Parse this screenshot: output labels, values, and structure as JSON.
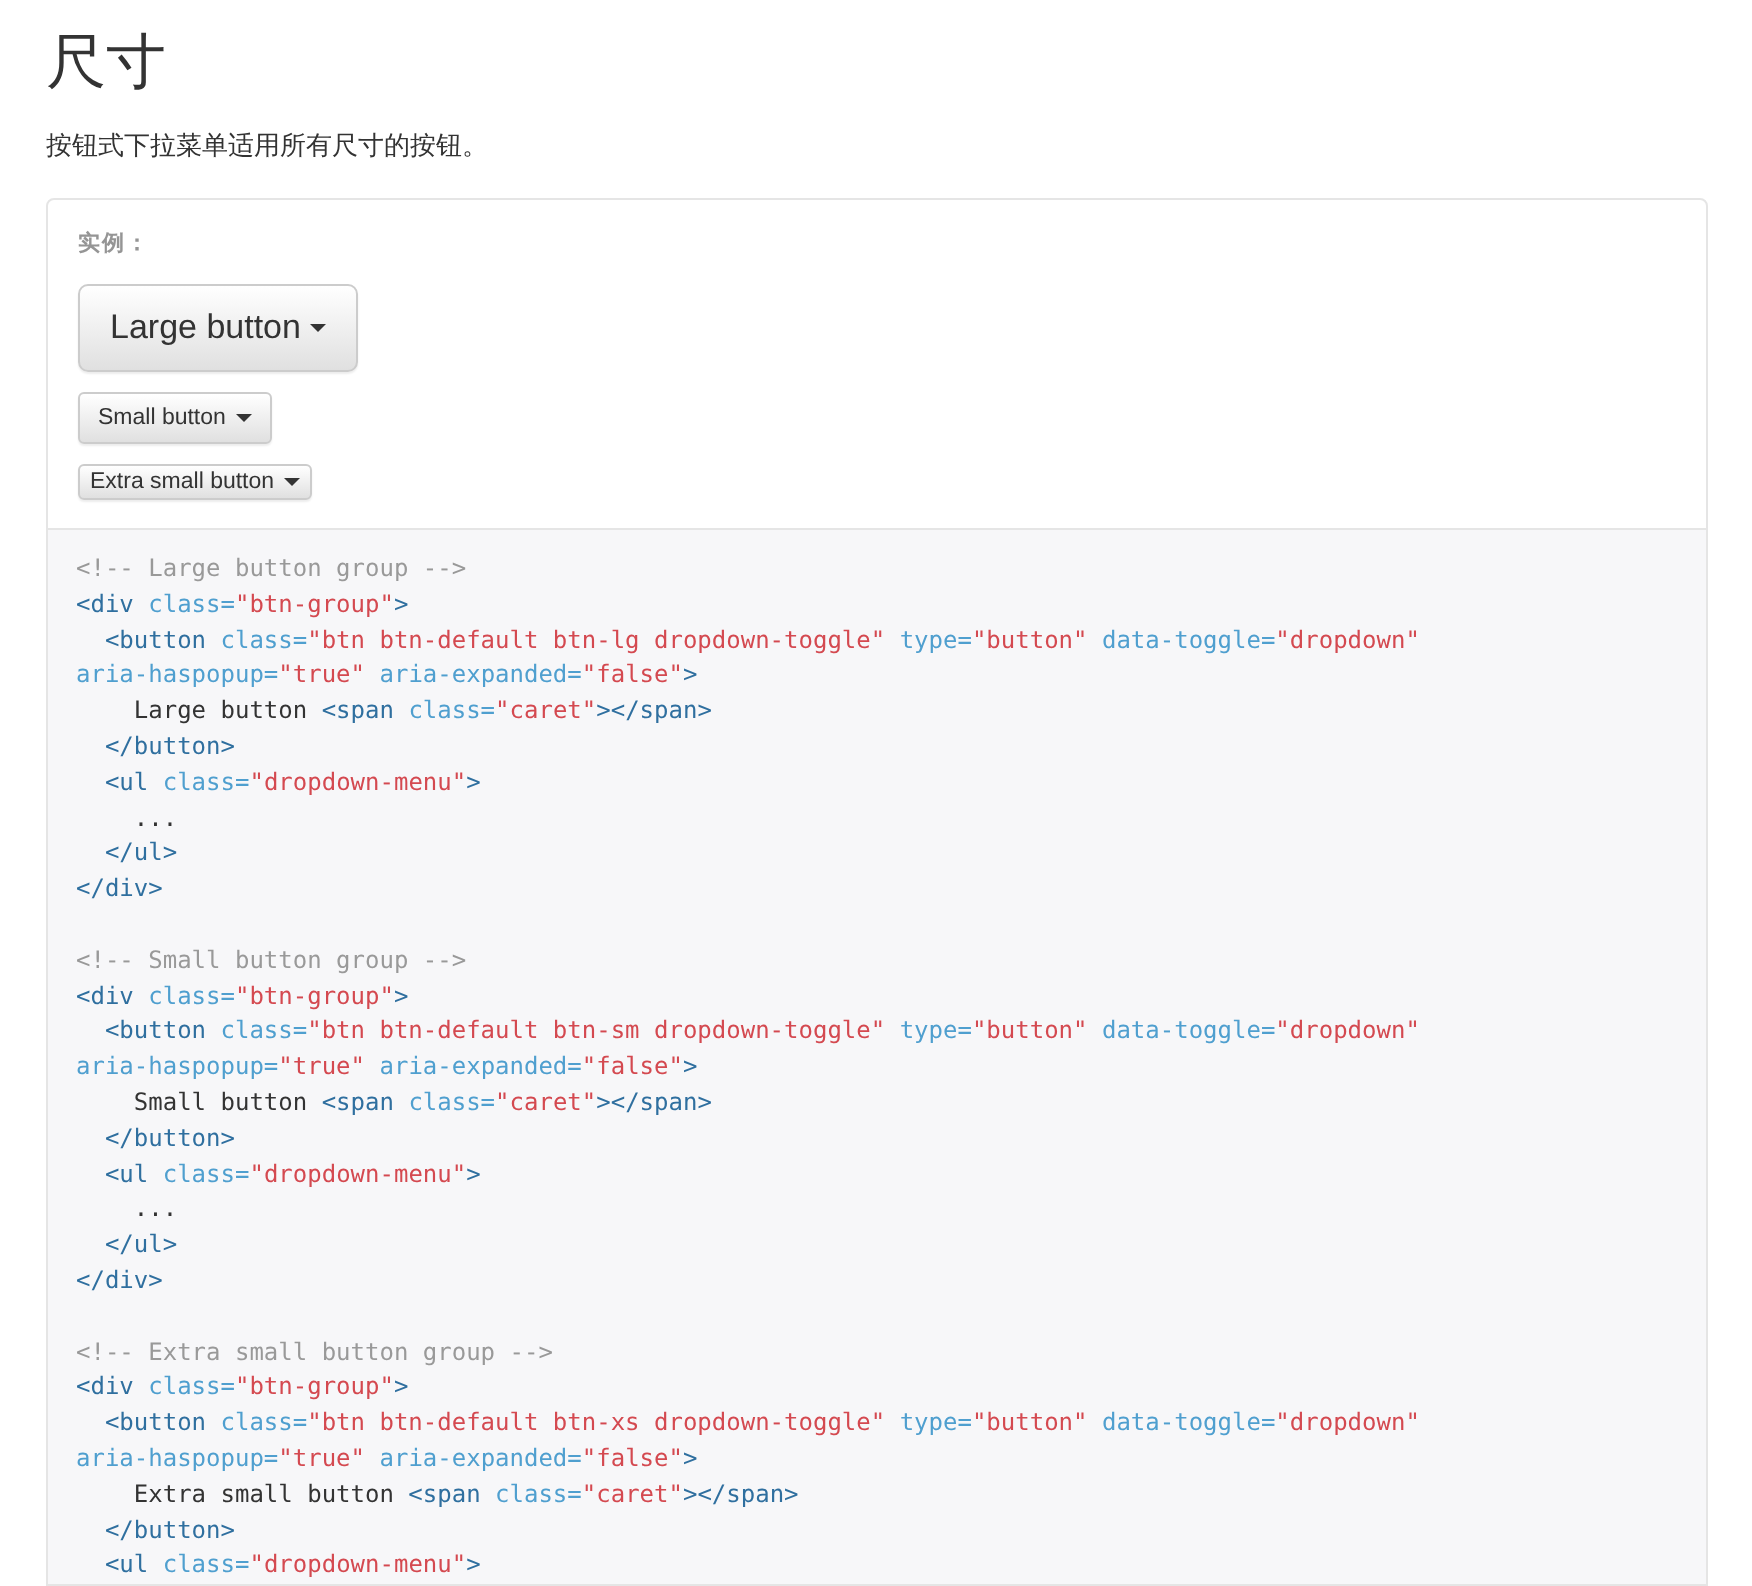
{
  "heading": "尺寸",
  "description": "按钮式下拉菜单适用所有尺寸的按钮。",
  "example": {
    "label": "实例：",
    "buttons": [
      {
        "kind": "large",
        "label": "Large button"
      },
      {
        "kind": "small",
        "label": "Small button"
      },
      {
        "kind": "mini",
        "label": "Extra small button"
      }
    ]
  },
  "code_blocks": [
    {
      "lines": [
        [
          {
            "kind": "comment",
            "text": "<!-- Large button group -->"
          }
        ],
        [
          {
            "kind": "tag",
            "text": "<div "
          },
          {
            "kind": "attr",
            "text": "class="
          },
          {
            "kind": "string",
            "text": "\"btn-group\""
          },
          {
            "kind": "tag",
            "text": ">"
          }
        ],
        [
          {
            "kind": "tag",
            "text": "  <button "
          },
          {
            "kind": "attr",
            "text": "class="
          },
          {
            "kind": "string",
            "text": "\"btn btn-default btn-lg dropdown-toggle\""
          },
          {
            "kind": "attr",
            "text": " type="
          },
          {
            "kind": "string",
            "text": "\"button\""
          },
          {
            "kind": "attr",
            "text": " data-toggle="
          },
          {
            "kind": "string",
            "text": "\"dropdown\""
          }
        ],
        [
          {
            "kind": "attr",
            "text": "aria-haspopup="
          },
          {
            "kind": "string",
            "text": "\"true\""
          },
          {
            "kind": "attr",
            "text": " aria-expanded="
          },
          {
            "kind": "string",
            "text": "\"false\""
          },
          {
            "kind": "tag",
            "text": ">"
          }
        ],
        [
          {
            "kind": "text",
            "text": "    Large button "
          },
          {
            "kind": "tag",
            "text": "<span "
          },
          {
            "kind": "attr",
            "text": "class="
          },
          {
            "kind": "string",
            "text": "\"caret\""
          },
          {
            "kind": "tag",
            "text": "></span>"
          }
        ],
        [
          {
            "kind": "tag",
            "text": "  </button>"
          }
        ],
        [
          {
            "kind": "tag",
            "text": "  <ul "
          },
          {
            "kind": "attr",
            "text": "class="
          },
          {
            "kind": "string",
            "text": "\"dropdown-menu\""
          },
          {
            "kind": "tag",
            "text": ">"
          }
        ],
        [
          {
            "kind": "text",
            "text": "    ..."
          }
        ],
        [
          {
            "kind": "tag",
            "text": "  </ul>"
          }
        ],
        [
          {
            "kind": "tag",
            "text": "</div>"
          }
        ]
      ]
    },
    {
      "lines": [
        [
          {
            "kind": "comment",
            "text": "<!-- Small button group -->"
          }
        ],
        [
          {
            "kind": "tag",
            "text": "<div "
          },
          {
            "kind": "attr",
            "text": "class="
          },
          {
            "kind": "string",
            "text": "\"btn-group\""
          },
          {
            "kind": "tag",
            "text": ">"
          }
        ],
        [
          {
            "kind": "tag",
            "text": "  <button "
          },
          {
            "kind": "attr",
            "text": "class="
          },
          {
            "kind": "string",
            "text": "\"btn btn-default btn-sm dropdown-toggle\""
          },
          {
            "kind": "attr",
            "text": " type="
          },
          {
            "kind": "string",
            "text": "\"button\""
          },
          {
            "kind": "attr",
            "text": " data-toggle="
          },
          {
            "kind": "string",
            "text": "\"dropdown\""
          }
        ],
        [
          {
            "kind": "attr",
            "text": "aria-haspopup="
          },
          {
            "kind": "string",
            "text": "\"true\""
          },
          {
            "kind": "attr",
            "text": " aria-expanded="
          },
          {
            "kind": "string",
            "text": "\"false\""
          },
          {
            "kind": "tag",
            "text": ">"
          }
        ],
        [
          {
            "kind": "text",
            "text": "    Small button "
          },
          {
            "kind": "tag",
            "text": "<span "
          },
          {
            "kind": "attr",
            "text": "class="
          },
          {
            "kind": "string",
            "text": "\"caret\""
          },
          {
            "kind": "tag",
            "text": "></span>"
          }
        ],
        [
          {
            "kind": "tag",
            "text": "  </button>"
          }
        ],
        [
          {
            "kind": "tag",
            "text": "  <ul "
          },
          {
            "kind": "attr",
            "text": "class="
          },
          {
            "kind": "string",
            "text": "\"dropdown-menu\""
          },
          {
            "kind": "tag",
            "text": ">"
          }
        ],
        [
          {
            "kind": "text",
            "text": "    ..."
          }
        ],
        [
          {
            "kind": "tag",
            "text": "  </ul>"
          }
        ],
        [
          {
            "kind": "tag",
            "text": "</div>"
          }
        ]
      ]
    },
    {
      "lines": [
        [
          {
            "kind": "comment",
            "text": "<!-- Extra small button group -->"
          }
        ],
        [
          {
            "kind": "tag",
            "text": "<div "
          },
          {
            "kind": "attr",
            "text": "class="
          },
          {
            "kind": "string",
            "text": "\"btn-group\""
          },
          {
            "kind": "tag",
            "text": ">"
          }
        ],
        [
          {
            "kind": "tag",
            "text": "  <button "
          },
          {
            "kind": "attr",
            "text": "class="
          },
          {
            "kind": "string",
            "text": "\"btn btn-default btn-xs dropdown-toggle\""
          },
          {
            "kind": "attr",
            "text": " type="
          },
          {
            "kind": "string",
            "text": "\"button\""
          },
          {
            "kind": "attr",
            "text": " data-toggle="
          },
          {
            "kind": "string",
            "text": "\"dropdown\""
          }
        ],
        [
          {
            "kind": "attr",
            "text": "aria-haspopup="
          },
          {
            "kind": "string",
            "text": "\"true\""
          },
          {
            "kind": "attr",
            "text": " aria-expanded="
          },
          {
            "kind": "string",
            "text": "\"false\""
          },
          {
            "kind": "tag",
            "text": ">"
          }
        ],
        [
          {
            "kind": "text",
            "text": "    Extra small button "
          },
          {
            "kind": "tag",
            "text": "<span "
          },
          {
            "kind": "attr",
            "text": "class="
          },
          {
            "kind": "string",
            "text": "\"caret\""
          },
          {
            "kind": "tag",
            "text": "></span>"
          }
        ],
        [
          {
            "kind": "tag",
            "text": "  </button>"
          }
        ],
        [
          {
            "kind": "tag",
            "text": "  <ul "
          },
          {
            "kind": "attr",
            "text": "class="
          },
          {
            "kind": "string",
            "text": "\"dropdown-menu\""
          },
          {
            "kind": "tag",
            "text": ">"
          }
        ]
      ]
    }
  ]
}
